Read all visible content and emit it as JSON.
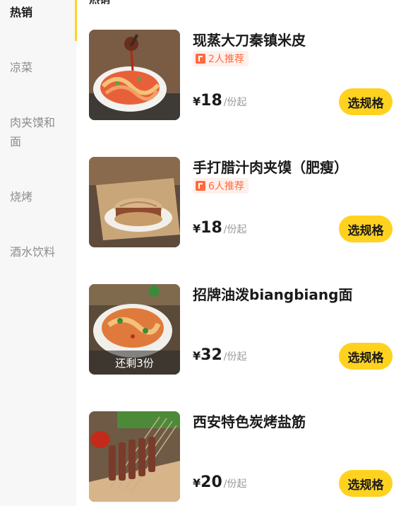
{
  "sidebar": {
    "items": [
      {
        "label": "热销",
        "active": true
      },
      {
        "label": "凉菜",
        "active": false
      },
      {
        "label": "肉夹馍和面",
        "active": false
      },
      {
        "label": "烧烤",
        "active": false
      },
      {
        "label": "酒水饮料",
        "active": false
      }
    ]
  },
  "main": {
    "section_title": "热销",
    "dishes": [
      {
        "name": "现蒸大刀秦镇米皮",
        "recommend": "2人推荐",
        "currency": "¥",
        "price": "18",
        "unit": "/份起",
        "button": "选规格"
      },
      {
        "name": "手打腊汁肉夹馍（肥瘦）",
        "recommend": "6人推荐",
        "currency": "¥",
        "price": "18",
        "unit": "/份起",
        "button": "选规格"
      },
      {
        "name": "招牌油泼biangbiang面",
        "stock": "还剩3份",
        "currency": "¥",
        "price": "32",
        "unit": "/份起",
        "button": "选规格"
      },
      {
        "name": "西安特色炭烤盐筋",
        "currency": "¥",
        "price": "20",
        "unit": "/份起",
        "button": "选规格"
      }
    ]
  },
  "colors": {
    "accent": "#ffd21f",
    "recommend": "#ff6a3d"
  }
}
